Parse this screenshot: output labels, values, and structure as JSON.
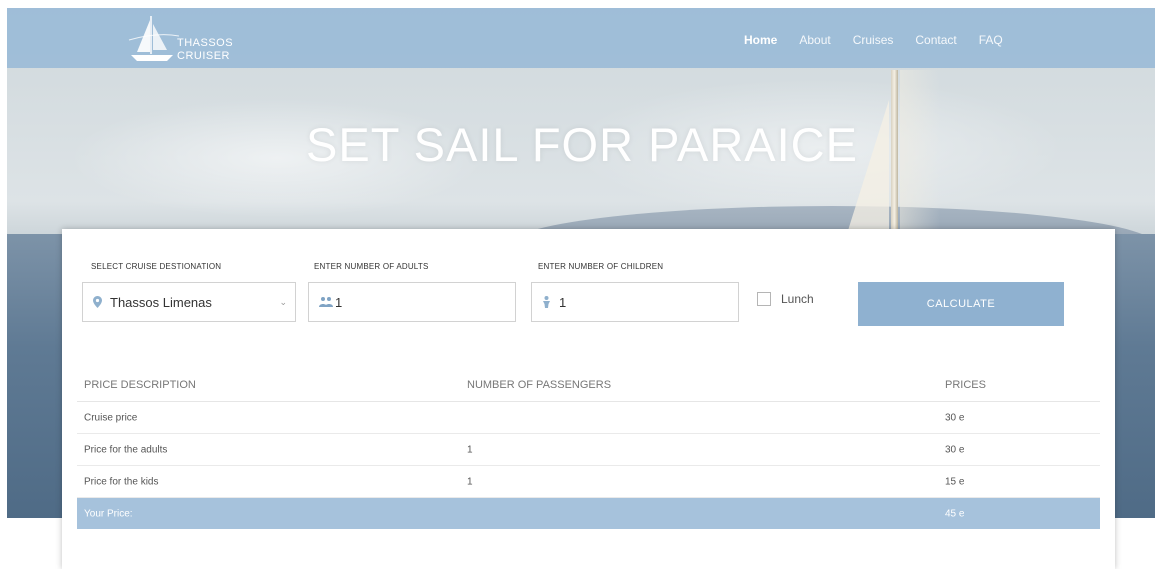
{
  "brand": {
    "line1": "THASSOS",
    "line2": "CRUISER",
    "icon": "sailboat-icon"
  },
  "nav": {
    "items": [
      {
        "label": "Home",
        "active": true
      },
      {
        "label": "About",
        "active": false
      },
      {
        "label": "Cruises",
        "active": false
      },
      {
        "label": "Contact",
        "active": false
      },
      {
        "label": "FAQ",
        "active": false
      }
    ]
  },
  "hero": {
    "title": "SET SAIL FOR PARAICE"
  },
  "form": {
    "destination": {
      "label": "SELECT CRUISE DESTIONATION",
      "value": "Thassos Limenas",
      "icon": "map-pin-icon"
    },
    "adults": {
      "label": "ENTER NUMBER OF ADULTS",
      "value": "1",
      "icon": "group-icon"
    },
    "children": {
      "label": "ENTER NUMBER OF CHILDREN",
      "value": "1",
      "icon": "child-icon"
    },
    "lunch": {
      "label": "Lunch",
      "checked": false
    },
    "calculate_label": "CALCULATE"
  },
  "price_table": {
    "headers": [
      "PRICE DESCRIPTION",
      "NUMBER OF PASSENGERS",
      "PRICES"
    ],
    "rows": [
      {
        "description": "Cruise price",
        "passengers": "",
        "price": "30 e"
      },
      {
        "description": "Price for the adults",
        "passengers": "1",
        "price": "30 e"
      },
      {
        "description": "Price for the kids",
        "passengers": "1",
        "price": "15 e"
      }
    ],
    "total": {
      "label": "Your Price:",
      "price": "45 e"
    }
  },
  "colors": {
    "accent": "#8fb1d0",
    "nav_bg": "#96b9d7",
    "total_row": "#a6c2dc"
  }
}
